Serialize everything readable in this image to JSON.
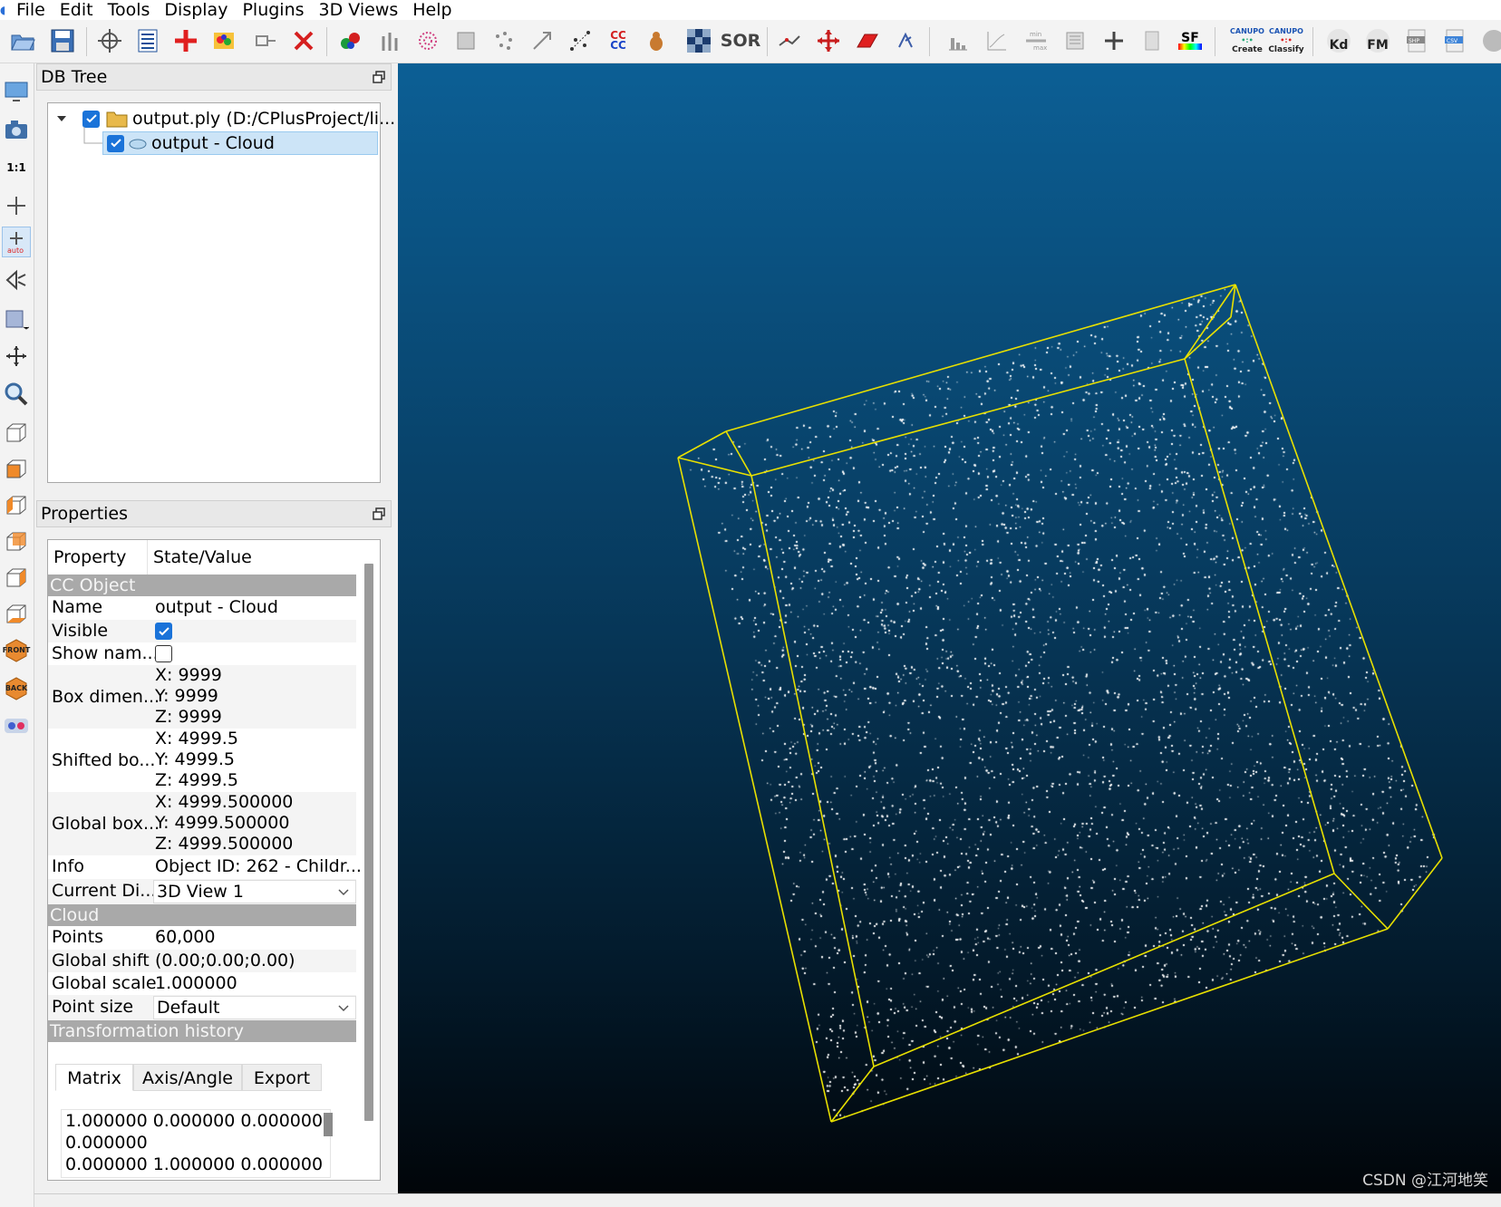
{
  "menubar": {
    "items": [
      "File",
      "Edit",
      "Tools",
      "Display",
      "Plugins",
      "3D Views",
      "Help"
    ]
  },
  "toolbar": {
    "sor_label": "SOR",
    "sf_label": "SF",
    "cc_label": "CC",
    "canupo_create_top": "CANUPO",
    "canupo_create_label": "Create",
    "canupo_classify_top": "CANUPO",
    "canupo_classify_label": "Classify",
    "kd_label": "Kd",
    "fm_label": "FM",
    "shp_label": "SHP",
    "csv_label": "CSV"
  },
  "lefttoolbar": {
    "one_to_one_label": "1:1",
    "front_label": "FRONT",
    "back_label": "BACK",
    "auto_label": "auto"
  },
  "dbtree": {
    "title": "DB Tree",
    "root_label": "output.ply (D:/CPlusProject/li...",
    "child_label": "output - Cloud"
  },
  "properties": {
    "title": "Properties",
    "col_property": "Property",
    "col_value": "State/Value",
    "section_ccobject": "CC Object",
    "name_key": "Name",
    "name_value": "output - Cloud",
    "visible_key": "Visible",
    "shownames_key": "Show nam...",
    "boxdim_key": "Box dimen...",
    "boxdim_x": "X: 9999",
    "boxdim_y": "Y: 9999",
    "boxdim_z": "Z: 9999",
    "shifted_key": "Shifted bo...",
    "shifted_x": "X: 4999.5",
    "shifted_y": "Y: 4999.5",
    "shifted_z": "Z: 4999.5",
    "global_key": "Global box...",
    "global_x": "X: 4999.500000",
    "global_y": "Y: 4999.500000",
    "global_z": "Z: 4999.500000",
    "info_key": "Info",
    "info_value": "Object ID: 262 - Childr...",
    "currentdisplay_key": "Current Di...",
    "currentdisplay_value": "3D View 1",
    "section_cloud": "Cloud",
    "points_key": "Points",
    "points_value": "60,000",
    "globalshift_key": "Global shift",
    "globalshift_value": "(0.00;0.00;0.00)",
    "globalscale_key": "Global scale",
    "globalscale_value": "1.000000",
    "pointsize_key": "Point size",
    "pointsize_value": "Default",
    "section_transform": "Transformation history",
    "tab_matrix": "Matrix",
    "tab_axis": "Axis/Angle",
    "tab_export": "Export",
    "matrix_line1": "1.000000 0.000000 0.000000",
    "matrix_line2": "0.000000",
    "matrix_line3": "0.000000 1.000000 0.000000"
  },
  "view": {
    "watermark": "CSDN @江河地笑",
    "bbox_color": "#e8e000",
    "point_color": "#ffffff"
  }
}
